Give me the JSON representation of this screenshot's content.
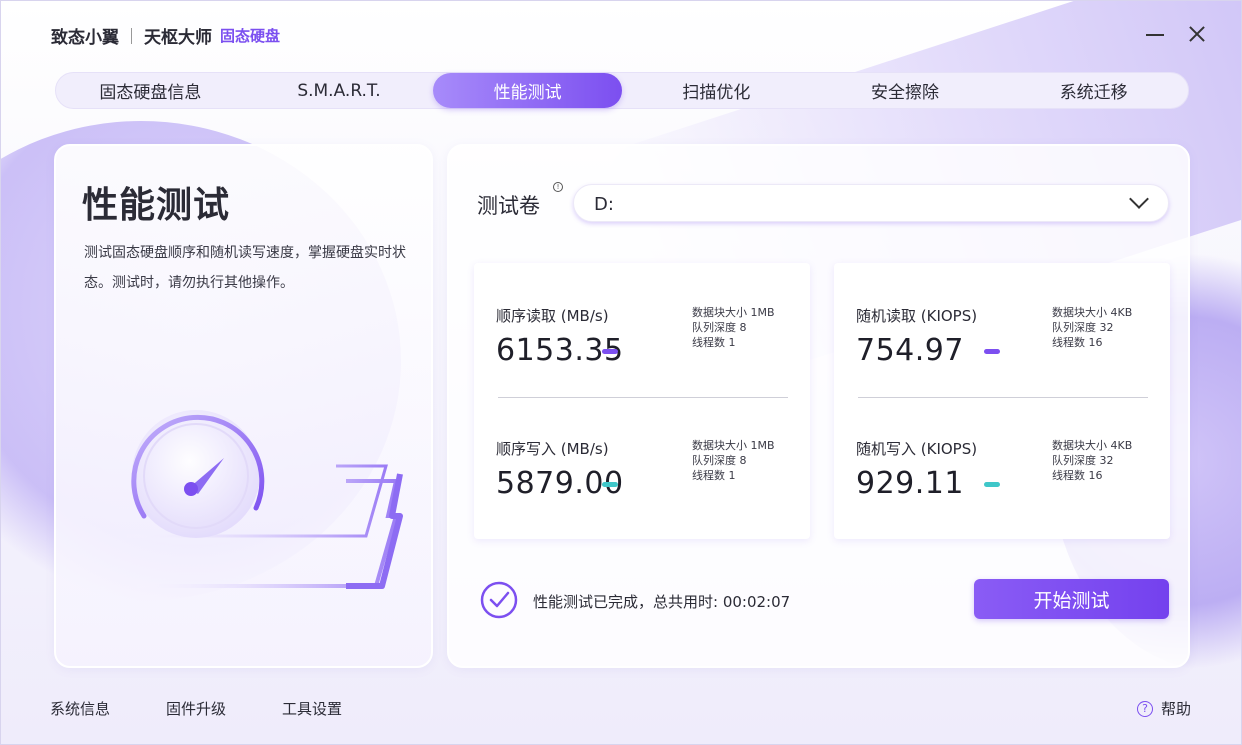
{
  "app": {
    "brand": "致态小翼",
    "product": "天枢大师",
    "product_sub": "固态硬盘"
  },
  "tabs": [
    {
      "label": "固态硬盘信息",
      "active": false
    },
    {
      "label": "S.M.A.R.T.",
      "active": false
    },
    {
      "label": "性能测试",
      "active": true
    },
    {
      "label": "扫描优化",
      "active": false
    },
    {
      "label": "安全擦除",
      "active": false
    },
    {
      "label": "系统迁移",
      "active": false
    }
  ],
  "left": {
    "title": "性能测试",
    "description": "测试固态硬盘顺序和随机读写速度，掌握硬盘实时状态。测试时，请勿执行其他操作。"
  },
  "volume": {
    "label": "测试卷",
    "info_glyph": "!",
    "selected": "D:"
  },
  "metrics": {
    "seq_read": {
      "label": "顺序读取 (MB/s)",
      "value": "6153.35",
      "specs": [
        "数据块大小 1MB",
        "队列深度 8",
        "线程数 1"
      ],
      "bar_color": "#7c4ff0"
    },
    "seq_write": {
      "label": "顺序写入 (MB/s)",
      "value": "5879.00",
      "specs": [
        "数据块大小 1MB",
        "队列深度 8",
        "线程数 1"
      ],
      "bar_color": "#3fc7c9"
    },
    "rand_read": {
      "label": "随机读取 (KIOPS)",
      "value": "754.97",
      "specs": [
        "数据块大小 4KB",
        "队列深度 32",
        "线程数 16"
      ],
      "bar_color": "#7c4ff0"
    },
    "rand_write": {
      "label": "随机写入 (KIOPS)",
      "value": "929.11",
      "specs": [
        "数据块大小 4KB",
        "队列深度 32",
        "线程数 16"
      ],
      "bar_color": "#3fc7c9"
    }
  },
  "status": {
    "text": "性能测试已完成，总共用时: 00:02:07"
  },
  "start_button": "开始测试",
  "footer": {
    "system_info": "系统信息",
    "firmware": "固件升级",
    "tools": "工具设置",
    "help": "帮助",
    "help_glyph": "?"
  },
  "colors": {
    "accent": "#7c4ff0",
    "teal": "#3fc7c9"
  }
}
